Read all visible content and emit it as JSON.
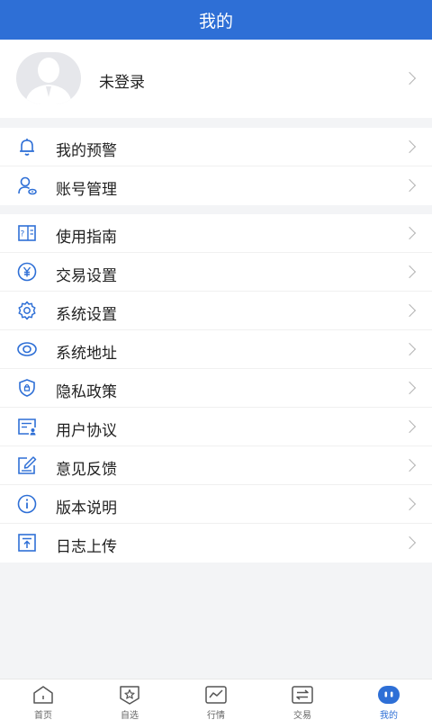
{
  "header": {
    "title": "我的"
  },
  "profile": {
    "name": "未登录"
  },
  "group1": [
    {
      "label": "我的预警",
      "icon": "bell-icon"
    },
    {
      "label": "账号管理",
      "icon": "account-icon"
    }
  ],
  "group2": [
    {
      "label": "使用指南",
      "icon": "guide-icon"
    },
    {
      "label": "交易设置",
      "icon": "yen-icon"
    },
    {
      "label": "系统设置",
      "icon": "gear-icon"
    },
    {
      "label": "系统地址",
      "icon": "eye-icon"
    },
    {
      "label": "隐私政策",
      "icon": "shield-lock-icon"
    },
    {
      "label": "用户协议",
      "icon": "agreement-icon"
    },
    {
      "label": "意见反馈",
      "icon": "edit-icon"
    },
    {
      "label": "版本说明",
      "icon": "info-icon"
    },
    {
      "label": "日志上传",
      "icon": "upload-icon"
    }
  ],
  "tabs": [
    {
      "label": "首页",
      "icon": "home-icon"
    },
    {
      "label": "自选",
      "icon": "star-shield-icon"
    },
    {
      "label": "行情",
      "icon": "chart-icon"
    },
    {
      "label": "交易",
      "icon": "exchange-icon"
    },
    {
      "label": "我的",
      "icon": "profile-icon",
      "active": true
    }
  ],
  "colors": {
    "primary": "#2e6fd6",
    "background": "#f3f4f6"
  }
}
